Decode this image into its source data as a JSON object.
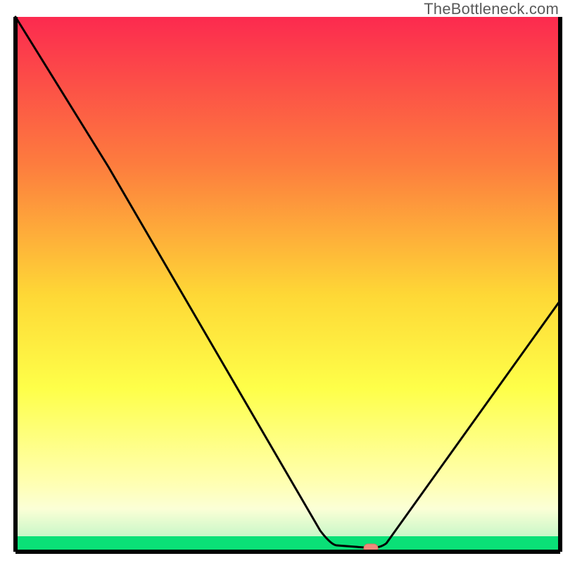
{
  "attribution": "TheBottleneck.com",
  "colors": {
    "gradient_top": "#fc2a4f",
    "gradient_mid1": "#fd7d3e",
    "gradient_mid2": "#fed836",
    "gradient_mid3": "#feff49",
    "gradient_bottom": "#ffffb0",
    "green_band": "#0ae077",
    "curve": "#000000",
    "border": "#000000",
    "marker_fill": "#f08a7c",
    "marker_stroke": "#e07060"
  },
  "chart_data": {
    "type": "line",
    "title": "",
    "xlabel": "",
    "ylabel": "",
    "xlim": [
      0,
      100
    ],
    "ylim": [
      0,
      100
    ],
    "green_band_range": [
      0,
      3
    ],
    "light_band_range": [
      3,
      14
    ],
    "curve_points": [
      {
        "x": 0,
        "y": 100
      },
      {
        "x": 17,
        "y": 72
      },
      {
        "x": 56,
        "y": 4
      },
      {
        "x": 58,
        "y": 1.2
      },
      {
        "x": 65,
        "y": 0.7
      },
      {
        "x": 68,
        "y": 1.5
      },
      {
        "x": 100,
        "y": 47
      }
    ],
    "marker": {
      "x": 65,
      "y": 0.7
    }
  }
}
